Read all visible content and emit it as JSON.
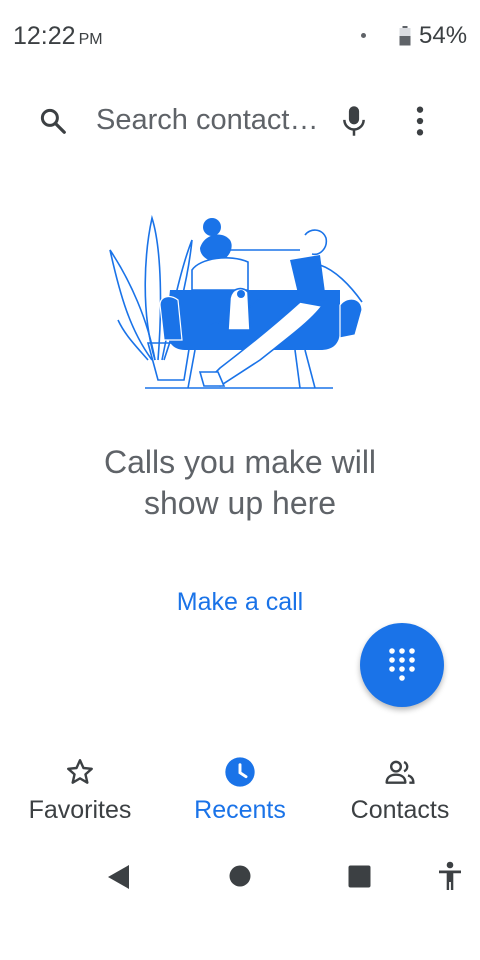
{
  "status_bar": {
    "time": "12:22",
    "ampm": "PM",
    "battery_percent": "54%",
    "battery_level": 0.54
  },
  "search": {
    "placeholder": "Search contact…",
    "icons": [
      "search-icon",
      "mic-icon",
      "more-vert-icon"
    ]
  },
  "empty_state": {
    "message": "Calls you make will show up here",
    "action_label": "Make a call",
    "illustration": "person-on-couch-with-dog"
  },
  "fab": {
    "icon": "dialpad-icon"
  },
  "bottom_nav": {
    "tabs": [
      {
        "label": "Favorites",
        "icon": "star-outline-icon",
        "active": false
      },
      {
        "label": "Recents",
        "icon": "clock-icon",
        "active": true
      },
      {
        "label": "Contacts",
        "icon": "people-icon",
        "active": false
      }
    ]
  },
  "system_nav": {
    "buttons": [
      "back-icon",
      "home-icon",
      "recents-square-icon",
      "accessibility-icon"
    ]
  },
  "colors": {
    "accent": "#1a73e8",
    "text_primary": "#3c4043",
    "text_secondary": "#5f6368",
    "background": "#ffffff"
  }
}
